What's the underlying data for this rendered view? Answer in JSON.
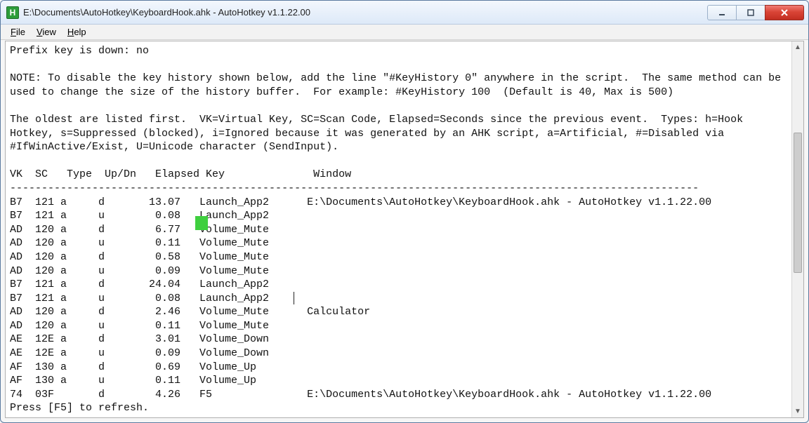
{
  "titlebar": {
    "icon_letter": "H",
    "title": "E:\\Documents\\AutoHotkey\\KeyboardHook.ahk - AutoHotkey v1.1.22.00"
  },
  "menu": {
    "file": "File",
    "view": "View",
    "help": "Help"
  },
  "body": {
    "prefix_line": "Prefix key is down: no",
    "note_line1": "NOTE: To disable the key history shown below, add the line \"#KeyHistory 0\" anywhere in the script.  The same method can be",
    "note_line2": "used to change the size of the history buffer.  For example: #KeyHistory 100  (Default is 40, Max is 500)",
    "legend_line1": "The oldest are listed first.  VK=Virtual Key, SC=Scan Code, Elapsed=Seconds since the previous event.  Types: h=Hook",
    "legend_line2": "Hotkey, s=Suppressed (blocked), i=Ignored because it was generated by an AHK script, a=Artificial, #=Disabled via",
    "legend_line3": "#IfWinActive/Exist, U=Unicode character (SendInput).",
    "header": "VK  SC   Type  Up/Dn   Elapsed Key              Window",
    "divider": "-------------------------------------------------------------------------------------------------------------",
    "rows": [
      {
        "vk": "B7",
        "sc": "121",
        "type": "a",
        "ud": "d",
        "elapsed": "13.07",
        "key": "Launch_App2",
        "win": "E:\\Documents\\AutoHotkey\\KeyboardHook.ahk - AutoHotkey v1.1.22.00"
      },
      {
        "vk": "B7",
        "sc": "121",
        "type": "a",
        "ud": "u",
        "elapsed": "0.08",
        "key": "Launch_App2",
        "win": ""
      },
      {
        "vk": "AD",
        "sc": "120",
        "type": "a",
        "ud": "d",
        "elapsed": "6.77",
        "key": "Volume_Mute",
        "win": ""
      },
      {
        "vk": "AD",
        "sc": "120",
        "type": "a",
        "ud": "u",
        "elapsed": "0.11",
        "key": "Volume_Mute",
        "win": ""
      },
      {
        "vk": "AD",
        "sc": "120",
        "type": "a",
        "ud": "d",
        "elapsed": "0.58",
        "key": "Volume_Mute",
        "win": ""
      },
      {
        "vk": "AD",
        "sc": "120",
        "type": "a",
        "ud": "u",
        "elapsed": "0.09",
        "key": "Volume_Mute",
        "win": ""
      },
      {
        "vk": "B7",
        "sc": "121",
        "type": "a",
        "ud": "d",
        "elapsed": "24.04",
        "key": "Launch_App2",
        "win": ""
      },
      {
        "vk": "B7",
        "sc": "121",
        "type": "a",
        "ud": "u",
        "elapsed": "0.08",
        "key": "Launch_App2",
        "win": ""
      },
      {
        "vk": "AD",
        "sc": "120",
        "type": "a",
        "ud": "d",
        "elapsed": "2.46",
        "key": "Volume_Mute",
        "win": "Calculator"
      },
      {
        "vk": "AD",
        "sc": "120",
        "type": "a",
        "ud": "u",
        "elapsed": "0.11",
        "key": "Volume_Mute",
        "win": ""
      },
      {
        "vk": "AE",
        "sc": "12E",
        "type": "a",
        "ud": "d",
        "elapsed": "3.01",
        "key": "Volume_Down",
        "win": ""
      },
      {
        "vk": "AE",
        "sc": "12E",
        "type": "a",
        "ud": "u",
        "elapsed": "0.09",
        "key": "Volume_Down",
        "win": ""
      },
      {
        "vk": "AF",
        "sc": "130",
        "type": "a",
        "ud": "d",
        "elapsed": "0.69",
        "key": "Volume_Up",
        "win": ""
      },
      {
        "vk": "AF",
        "sc": "130",
        "type": "a",
        "ud": "u",
        "elapsed": "0.11",
        "key": "Volume_Up",
        "win": ""
      },
      {
        "vk": "74",
        "sc": "03F",
        "type": "",
        "ud": "d",
        "elapsed": "4.26",
        "key": "F5",
        "win": "E:\\Documents\\AutoHotkey\\KeyboardHook.ahk - AutoHotkey v1.1.22.00"
      }
    ],
    "footer": "Press [F5] to refresh."
  }
}
